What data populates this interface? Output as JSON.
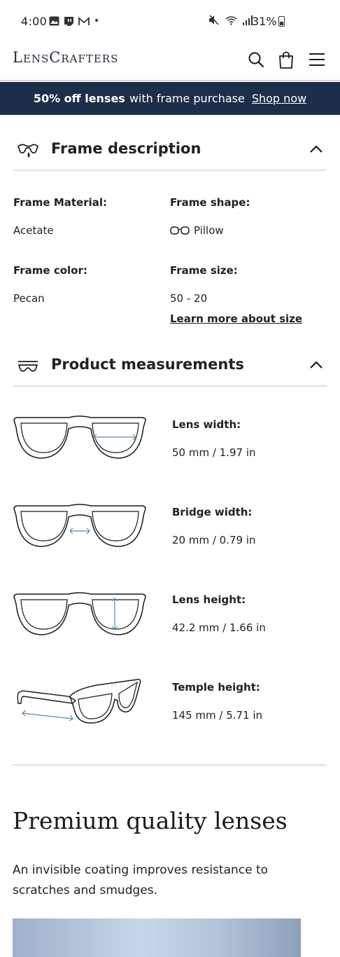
{
  "status_bar": {
    "time": "4:00",
    "left_icons": [
      "gallery-icon",
      "twitch-icon",
      "gmail-icon"
    ],
    "dot": "•",
    "battery": "31%"
  },
  "header": {
    "logo": "LensCrafters",
    "icons": [
      "search-icon",
      "bag-icon",
      "menu-icon"
    ]
  },
  "promo": {
    "bold": "50% off lenses",
    "text": "with frame purchase",
    "link": "Shop now"
  },
  "frame_description": {
    "title": "Frame description",
    "items": [
      {
        "label": "Frame Material:",
        "value": "Acetate"
      },
      {
        "label": "Frame shape:",
        "value": "Pillow"
      },
      {
        "label": "Frame color:",
        "value": "Pecan"
      },
      {
        "label": "Frame size:",
        "value": "50 - 20"
      }
    ],
    "size_link": "Learn more about size"
  },
  "product_measurements": {
    "title": "Product measurements",
    "items": [
      {
        "label": "Lens width:",
        "value": "50 mm / 1.97 in"
      },
      {
        "label": "Bridge width:",
        "value": "20 mm / 0.79 in"
      },
      {
        "label": "Lens height:",
        "value": "42.2 mm / 1.66 in"
      },
      {
        "label": "Temple height:",
        "value": "145 mm / 5.71 in"
      }
    ]
  },
  "premium": {
    "title": "Premium quality lenses",
    "text": "An invisible coating improves resistance to scratches and smudges."
  },
  "colors": {
    "promo_bg": "#1c2e4a",
    "measure_arrow": "#5b8aa6"
  }
}
